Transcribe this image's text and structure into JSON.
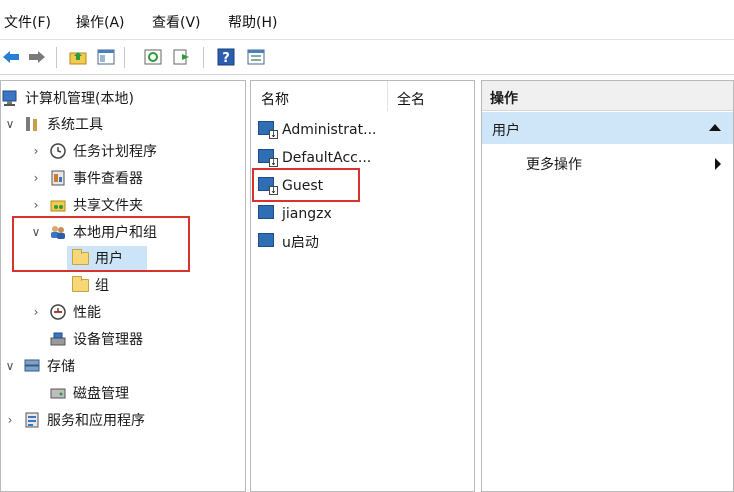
{
  "menu": {
    "items": [
      {
        "label": "文件(F)"
      },
      {
        "label": "操作(A)"
      },
      {
        "label": "查看(V)"
      },
      {
        "label": "帮助(H)"
      }
    ]
  },
  "toolbar": {
    "buttons": [
      {
        "icon": "back-arrow-icon"
      },
      {
        "icon": "forward-arrow-icon"
      },
      {
        "icon": "up-folder-icon"
      },
      {
        "icon": "show-hide-tree-icon"
      },
      {
        "icon": "refresh-icon"
      },
      {
        "icon": "export-list-icon"
      },
      {
        "icon": "help-icon"
      },
      {
        "icon": "properties-icon"
      }
    ]
  },
  "tree": {
    "root": "计算机管理(本地)",
    "system_tools": "系统工具",
    "task_scheduler": "任务计划程序",
    "event_viewer": "事件查看器",
    "shared_folders": "共享文件夹",
    "local_users_groups": "本地用户和组",
    "users": "用户",
    "groups": "组",
    "performance": "性能",
    "device_manager": "设备管理器",
    "storage": "存储",
    "disk_management": "磁盘管理",
    "services_apps": "服务和应用程序"
  },
  "list": {
    "col_name": "名称",
    "col_fullname": "全名",
    "users": [
      {
        "name": "Administrat..."
      },
      {
        "name": "DefaultAcc..."
      },
      {
        "name": "Guest"
      },
      {
        "name": "jiangzx"
      },
      {
        "name": "u启动"
      }
    ]
  },
  "actions": {
    "header": "操作",
    "group_label": "用户",
    "more_actions": "更多操作"
  },
  "colors": {
    "highlight_box": "#d9322e",
    "selection": "#cce4f7",
    "action_group": "#cfe6f8"
  }
}
